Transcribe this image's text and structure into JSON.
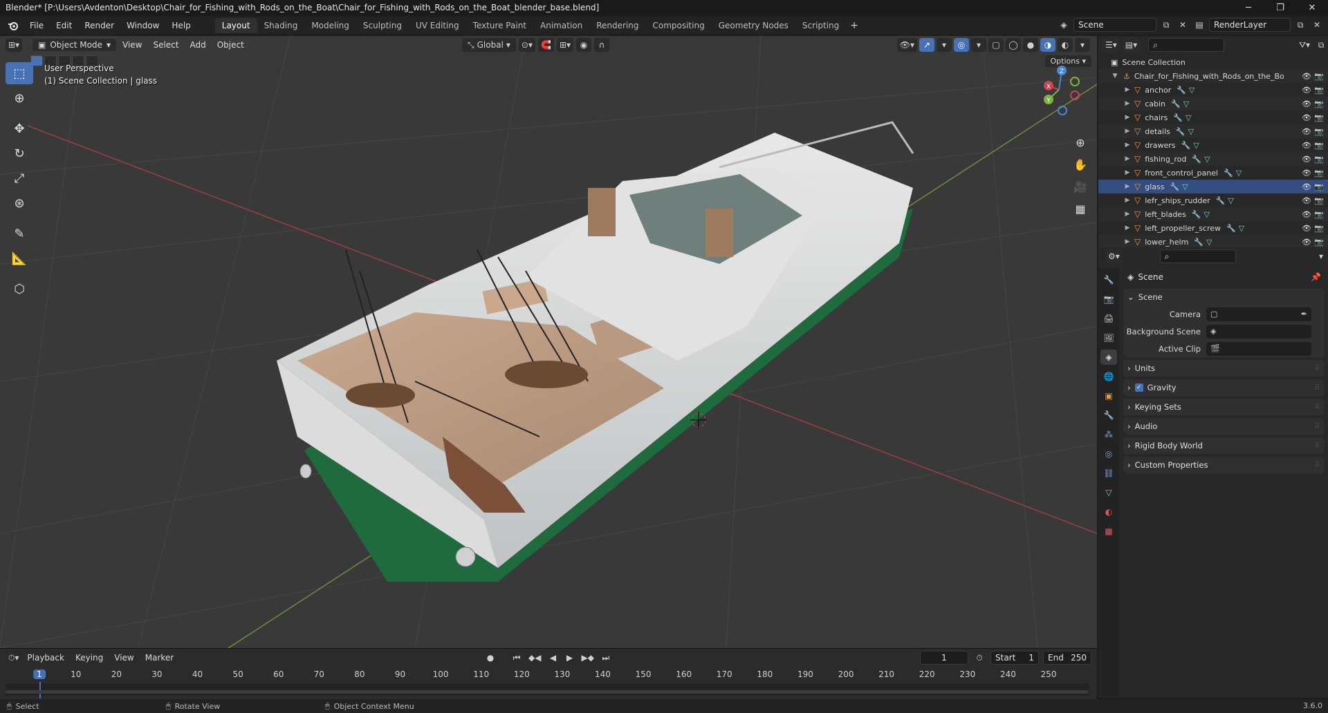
{
  "window": {
    "title": "Blender* [P:\\Users\\Avdenton\\Desktop\\Chair_for_Fishing_with_Rods_on_the_Boat\\Chair_for_Fishing_with_Rods_on_the_Boat_blender_base.blend]",
    "minimize": "─",
    "maximize": "❐",
    "close": "✕"
  },
  "menu": [
    "File",
    "Edit",
    "Render",
    "Window",
    "Help"
  ],
  "workspaces": [
    "Layout",
    "Shading",
    "Modeling",
    "Sculpting",
    "UV Editing",
    "Texture Paint",
    "Animation",
    "Rendering",
    "Compositing",
    "Geometry Nodes",
    "Scripting"
  ],
  "active_workspace": "Layout",
  "scene_selector": "Scene",
  "view_layer": "RenderLayer",
  "viewport": {
    "mode": "Object Mode",
    "menus": [
      "View",
      "Select",
      "Add",
      "Object"
    ],
    "transform_orientation": "Global",
    "options": "Options",
    "info_line1": "User Perspective",
    "info_line2": "(1) Scene Collection | glass",
    "gizmo_axes": [
      "X",
      "Y",
      "Z"
    ]
  },
  "timeline": {
    "menus": [
      "Playback",
      "Keying",
      "View",
      "Marker"
    ],
    "current_frame": "1",
    "start_label": "Start",
    "start": "1",
    "end_label": "End",
    "end": "250",
    "ticks": [
      "1",
      "10",
      "20",
      "30",
      "40",
      "50",
      "60",
      "70",
      "80",
      "90",
      "100",
      "110",
      "120",
      "130",
      "140",
      "150",
      "160",
      "170",
      "180",
      "190",
      "200",
      "210",
      "220",
      "230",
      "240",
      "250"
    ]
  },
  "statusbar": {
    "select": "Select",
    "rotate": "Rotate View",
    "context": "Object Context Menu",
    "version": "3.6.0"
  },
  "outliner": {
    "root": "Scene Collection",
    "collection": "Chair_for_Fishing_with_Rods_on_the_Bo",
    "objects": [
      "anchor",
      "cabin",
      "chairs",
      "details",
      "drawers",
      "fishing_rod",
      "front_control_panel",
      "glass",
      "lefr_ships_rudder",
      "left_blades",
      "left_propeller_screw",
      "lower_helm"
    ],
    "selected": "glass"
  },
  "properties": {
    "context_title": "Scene",
    "panel_scene": "Scene",
    "camera_label": "Camera",
    "background_label": "Background Scene",
    "clip_label": "Active Clip",
    "sub_panels": [
      "Units",
      "Gravity",
      "Keying Sets",
      "Audio",
      "Rigid Body World",
      "Custom Properties"
    ]
  },
  "colors": {
    "accent": "#4772b3",
    "x_axis": "#c94452",
    "y_axis": "#7cb342",
    "z_axis": "#4a84d4",
    "hull_green": "#1f6b3e"
  }
}
